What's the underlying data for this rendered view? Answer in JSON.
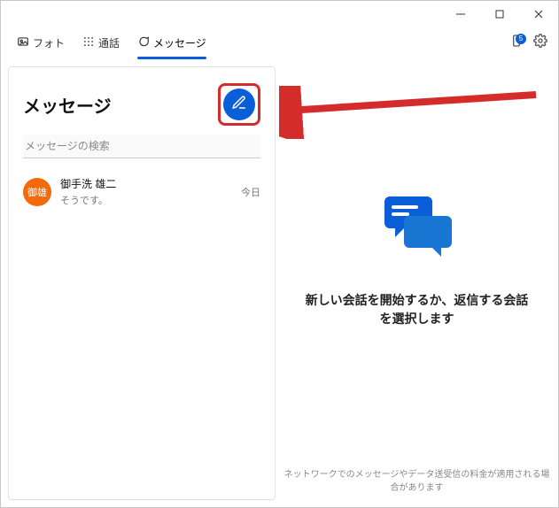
{
  "header": {
    "tabs": [
      {
        "label": "フォト"
      },
      {
        "label": "通話"
      },
      {
        "label": "メッセージ"
      }
    ],
    "notification_count": "5"
  },
  "side": {
    "title": "メッセージ",
    "search_placeholder": "メッセージの検索",
    "conversations": [
      {
        "avatar_initials": "御雄",
        "name": "御手洗 雄二",
        "preview": "そうです。",
        "time": "今日"
      }
    ]
  },
  "main": {
    "empty_message": "新しい会話を開始するか、返信する会話を選択します",
    "footer": "ネットワークでのメッセージやデータ送受信の料金が適用される場合があります"
  },
  "colors": {
    "accent": "#0a5fd9",
    "annotation": "#d42b2b",
    "avatar": "#f26a0a"
  }
}
